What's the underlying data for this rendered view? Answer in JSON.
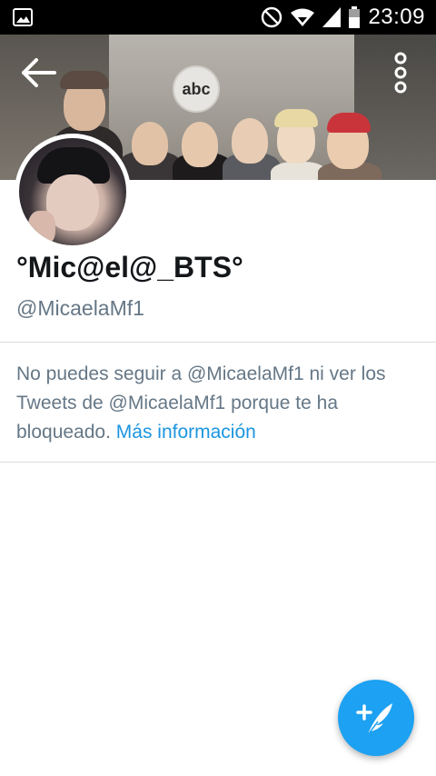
{
  "status_bar": {
    "time": "23:09",
    "icons": [
      "image-notification-icon",
      "do-not-disturb-icon",
      "wifi-icon",
      "cell-signal-icon",
      "battery-icon"
    ]
  },
  "header": {
    "banner_text": "abc",
    "back_icon": "arrow-left-icon",
    "more_icon": "vertical-dots-icon"
  },
  "profile": {
    "display_name": "°Mic@el@_BTS°",
    "handle": "@MicaelaMf1"
  },
  "blocked_notice": {
    "message": "No puedes seguir a @MicaelaMf1 ni ver los Tweets de @MicaelaMf1 porque te ha bloqueado.",
    "link_label": "Más información"
  },
  "fab": {
    "icon": "compose-tweet-icon"
  },
  "colors": {
    "accent": "#1da1f2",
    "link": "#1b95e0",
    "secondary_text": "#657786",
    "primary_text": "#14171a"
  }
}
